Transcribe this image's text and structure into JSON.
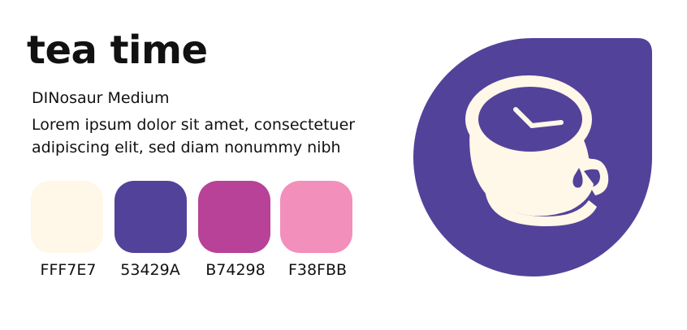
{
  "title": "tea time",
  "font_name": "DINosaur Medium",
  "sample_text": {
    "line1": "Lorem ipsum dolor sit amet, consectetuer",
    "line2": "adipiscing elit, sed diam nonummy nibh"
  },
  "palette": [
    {
      "hex": "#FFF7E7",
      "label": "FFF7E7"
    },
    {
      "hex": "#53429A",
      "label": "53429A"
    },
    {
      "hex": "#B74298",
      "label": "B74298"
    },
    {
      "hex": "#F38FBB",
      "label": "F38FBB"
    }
  ],
  "logo": {
    "icon": "tea-cup-clock-icon",
    "background_color": "#53429A",
    "foreground_color": "#FFF7E7"
  }
}
